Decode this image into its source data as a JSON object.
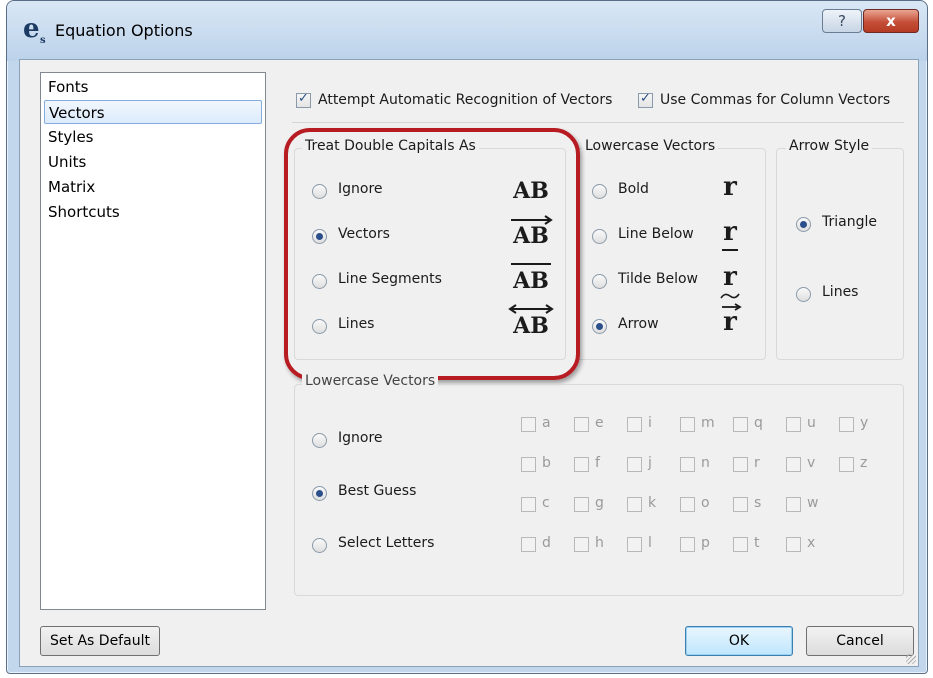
{
  "window": {
    "title": "Equation Options",
    "help_label": "?",
    "close_label": "x"
  },
  "nav": {
    "items": [
      {
        "label": "Fonts",
        "selected": false
      },
      {
        "label": "Vectors",
        "selected": true
      },
      {
        "label": "Styles",
        "selected": false
      },
      {
        "label": "Units",
        "selected": false
      },
      {
        "label": "Matrix",
        "selected": false
      },
      {
        "label": "Shortcuts",
        "selected": false
      }
    ]
  },
  "options": {
    "auto_recognition": {
      "label": "Attempt Automatic Recognition of Vectors",
      "checked": true
    },
    "commas_column": {
      "label": "Use Commas for Column Vectors",
      "checked": true
    }
  },
  "double_capitals": {
    "title": "Treat Double Capitals As",
    "options": [
      {
        "label": "Ignore",
        "symbol": "AB",
        "selected": false
      },
      {
        "label": "Vectors",
        "symbol": "AB",
        "selected": true
      },
      {
        "label": "Line Segments",
        "symbol": "AB",
        "selected": false
      },
      {
        "label": "Lines",
        "symbol": "AB",
        "selected": false
      }
    ]
  },
  "lowercase_style": {
    "title": "Lowercase Vectors",
    "options": [
      {
        "label": "Bold",
        "symbol": "r",
        "selected": false
      },
      {
        "label": "Line Below",
        "symbol": "r",
        "selected": false
      },
      {
        "label": "Tilde Below",
        "symbol": "r",
        "selected": false
      },
      {
        "label": "Arrow",
        "symbol": "r",
        "selected": true
      }
    ]
  },
  "arrow_style": {
    "title": "Arrow Style",
    "options": [
      {
        "label": "Triangle",
        "selected": true
      },
      {
        "label": "Lines",
        "selected": false
      }
    ]
  },
  "lowercase_letters": {
    "title": "Lowercase Vectors",
    "modes": [
      {
        "label": "Ignore",
        "selected": false
      },
      {
        "label": "Best Guess",
        "selected": true
      },
      {
        "label": "Select Letters",
        "selected": false
      }
    ],
    "letters": [
      "a",
      "e",
      "i",
      "m",
      "q",
      "u",
      "y",
      "b",
      "f",
      "j",
      "n",
      "r",
      "v",
      "z",
      "c",
      "g",
      "k",
      "o",
      "s",
      "w",
      "d",
      "h",
      "l",
      "p",
      "t",
      "x"
    ]
  },
  "buttons": {
    "set_default": "Set As Default",
    "ok": "OK",
    "cancel": "Cancel"
  },
  "colors": {
    "highlight": "#b71c23",
    "title_bar": "#c3d7ec",
    "close": "#c54f38"
  }
}
